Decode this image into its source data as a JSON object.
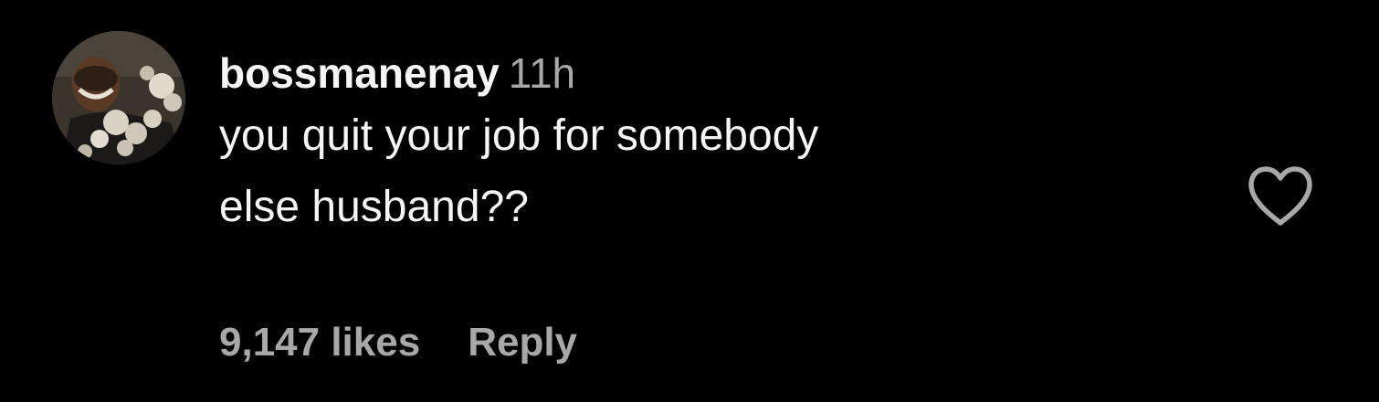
{
  "comment": {
    "username": "bossmanenay",
    "timestamp": "11h",
    "text_line_1": "you quit your job for somebody",
    "text_line_2": "else husband??",
    "likes": "9,147 likes",
    "reply_label": "Reply",
    "like_icon": "heart-outline-icon"
  },
  "colors": {
    "background": "#000000",
    "primary_text": "#f5f5f5",
    "secondary_text": "#a8a8a8",
    "icon": "#a8a8a8"
  }
}
